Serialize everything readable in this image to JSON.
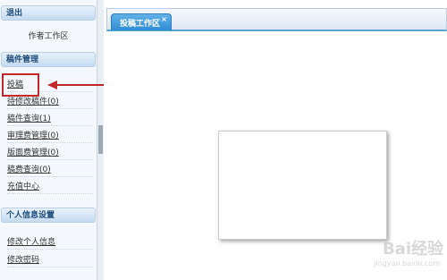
{
  "sidebar": {
    "logout_header": "退出",
    "author_workspace": "作者工作区",
    "manuscript_header": "稿件管理",
    "items": [
      {
        "label": "投稿"
      },
      {
        "label": "待修改稿件(0)"
      },
      {
        "label": "稿件查询(1)"
      },
      {
        "label": "审理费管理(0)"
      },
      {
        "label": "版面费管理(0)"
      },
      {
        "label": "稿费查询(0)"
      },
      {
        "label": "充值中心"
      }
    ],
    "personal_header": "个人信息设置",
    "personal_items": [
      {
        "label": "修改个人信息"
      },
      {
        "label": "修改密码"
      }
    ]
  },
  "main": {
    "tab_label": "投稿工作区",
    "tab_close": "×"
  },
  "watermark": {
    "line1": "Bai经验",
    "line2": "jingyan.baidu.com"
  },
  "colors": {
    "annotation_red": "#c0282a",
    "tab_blue": "#3a94d8",
    "header_text": "#1f4d7a"
  }
}
